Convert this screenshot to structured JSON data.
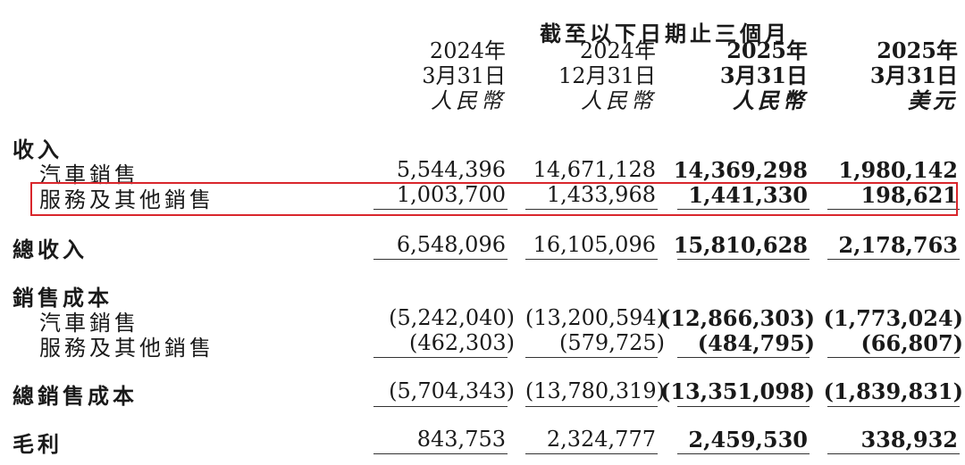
{
  "header": {
    "span_title": "截至以下日期止三個月",
    "columns": [
      {
        "year": "2024年",
        "date": "3月31日",
        "currency": "人民幣",
        "bold": false
      },
      {
        "year": "2024年",
        "date": "12月31日",
        "currency": "人民幣",
        "bold": false
      },
      {
        "year": "2025年",
        "date": "3月31日",
        "currency": "人民幣",
        "bold": true
      },
      {
        "year": "2025年",
        "date": "3月31日",
        "currency": "美元",
        "bold": true
      }
    ]
  },
  "rows": {
    "revenue_heading": "收入",
    "vehicle_sales": {
      "label": "汽車銷售",
      "values": [
        "5,544,396",
        "14,671,128",
        "14,369,298",
        "1,980,142"
      ]
    },
    "services_other": {
      "label": "服務及其他銷售",
      "values": [
        "1,003,700",
        "1,433,968",
        "1,441,330",
        "198,621"
      ]
    },
    "total_revenue": {
      "label": "總收入",
      "values": [
        "6,548,096",
        "16,105,096",
        "15,810,628",
        "2,178,763"
      ]
    },
    "cost_heading": "銷售成本",
    "cost_vehicle": {
      "label": "汽車銷售",
      "values": [
        "(5,242,040)",
        "(13,200,594)",
        "(12,866,303)",
        "(1,773,024)"
      ]
    },
    "cost_services": {
      "label": "服務及其他銷售",
      "values": [
        "(462,303)",
        "(579,725)",
        "(484,795)",
        "(66,807)"
      ]
    },
    "total_cost": {
      "label": "總銷售成本",
      "values": [
        "(5,704,343)",
        "(13,780,319)",
        "(13,351,098)",
        "(1,839,831)"
      ]
    },
    "gross_profit": {
      "label": "毛利",
      "values": [
        "843,753",
        "2,324,777",
        "2,459,530",
        "338,932"
      ]
    }
  },
  "highlight_color": "#d9262c"
}
